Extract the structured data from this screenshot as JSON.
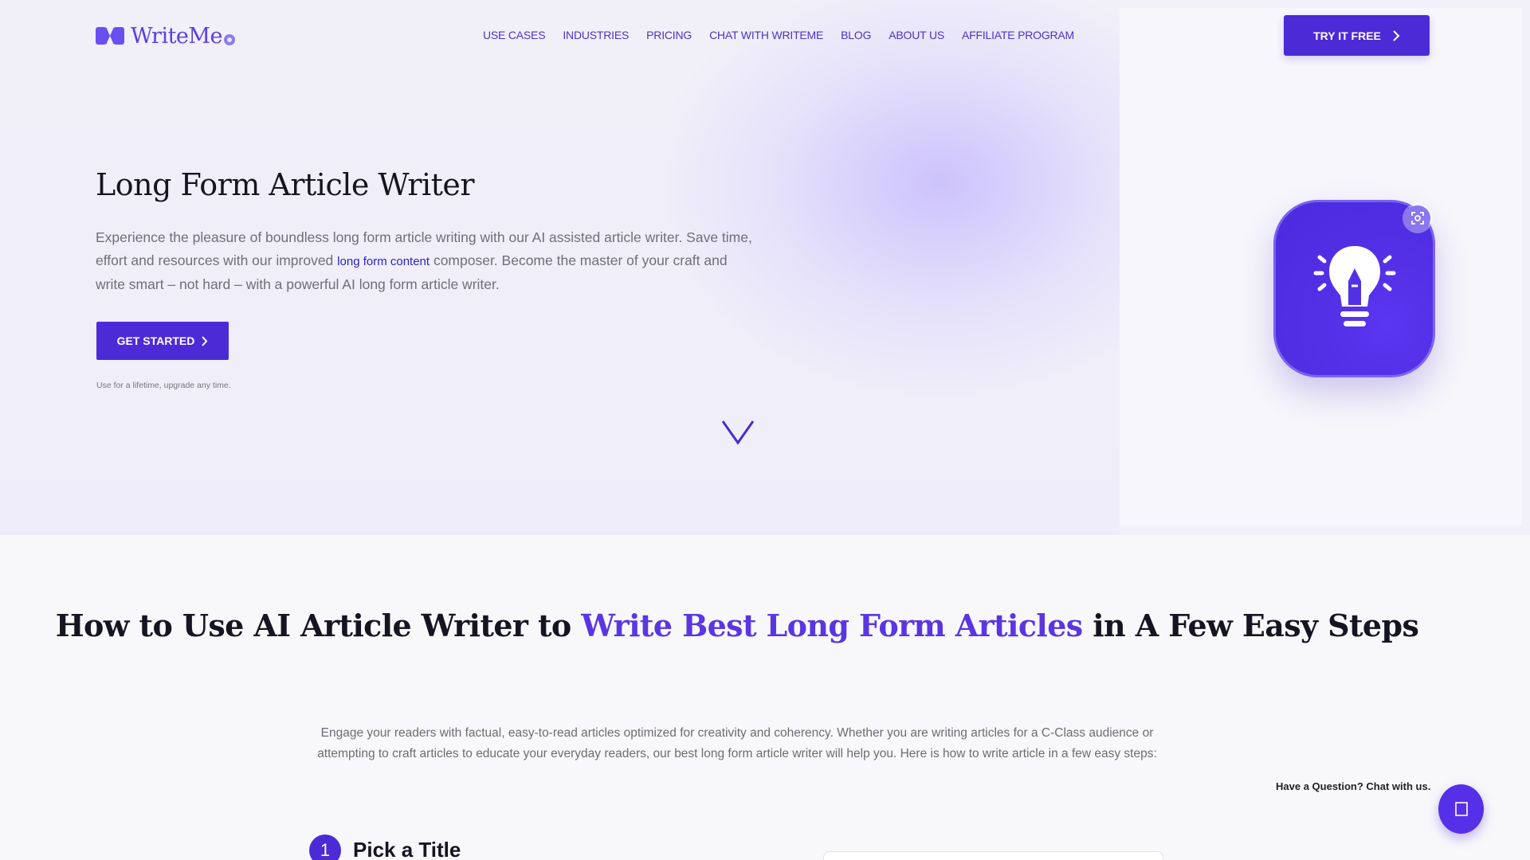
{
  "brand": {
    "name": "WriteMe",
    "accent": "#4b2bd6"
  },
  "nav": {
    "items": [
      {
        "label": "USE CASES"
      },
      {
        "label": "INDUSTRIES"
      },
      {
        "label": "PRICING"
      },
      {
        "label": "CHAT WITH WRITEME"
      },
      {
        "label": "BLOG"
      },
      {
        "label": "ABOUT US"
      },
      {
        "label": "AFFILIATE PROGRAM"
      }
    ],
    "cta_label": "TRY IT FREE"
  },
  "hero": {
    "title": "Long Form Article Writer",
    "desc_part1": "Experience the pleasure of boundless long form article writing with our AI assisted article writer. Save time, effort and resources with our improved ",
    "desc_link": "long form content",
    "desc_part2": " composer. Become the master of your craft and write smart – not hard – with a powerful AI long form article writer.",
    "cta_label": "GET STARTED",
    "note": "Use for a lifetime, upgrade any time.",
    "app_icon": "lightbulb-pencil-icon"
  },
  "steps_section": {
    "title_plain_1": "How to Use AI Article Writer to ",
    "title_accent": "Write Best Long Form Articles",
    "title_plain_2": " in A Few Easy Steps",
    "description": "Engage your readers with factual, easy-to-read articles optimized for creativity and coherency. Whether you are writing articles for a C-Class audience or attempting to craft articles to educate your everyday readers, our best long form article writer will help you. Here is how to write article in a few easy steps:",
    "step1_number": "1",
    "step1_title": "Pick a Title"
  },
  "chat": {
    "label": "Have a Question? Chat with us.",
    "icon": "chat-icon"
  }
}
